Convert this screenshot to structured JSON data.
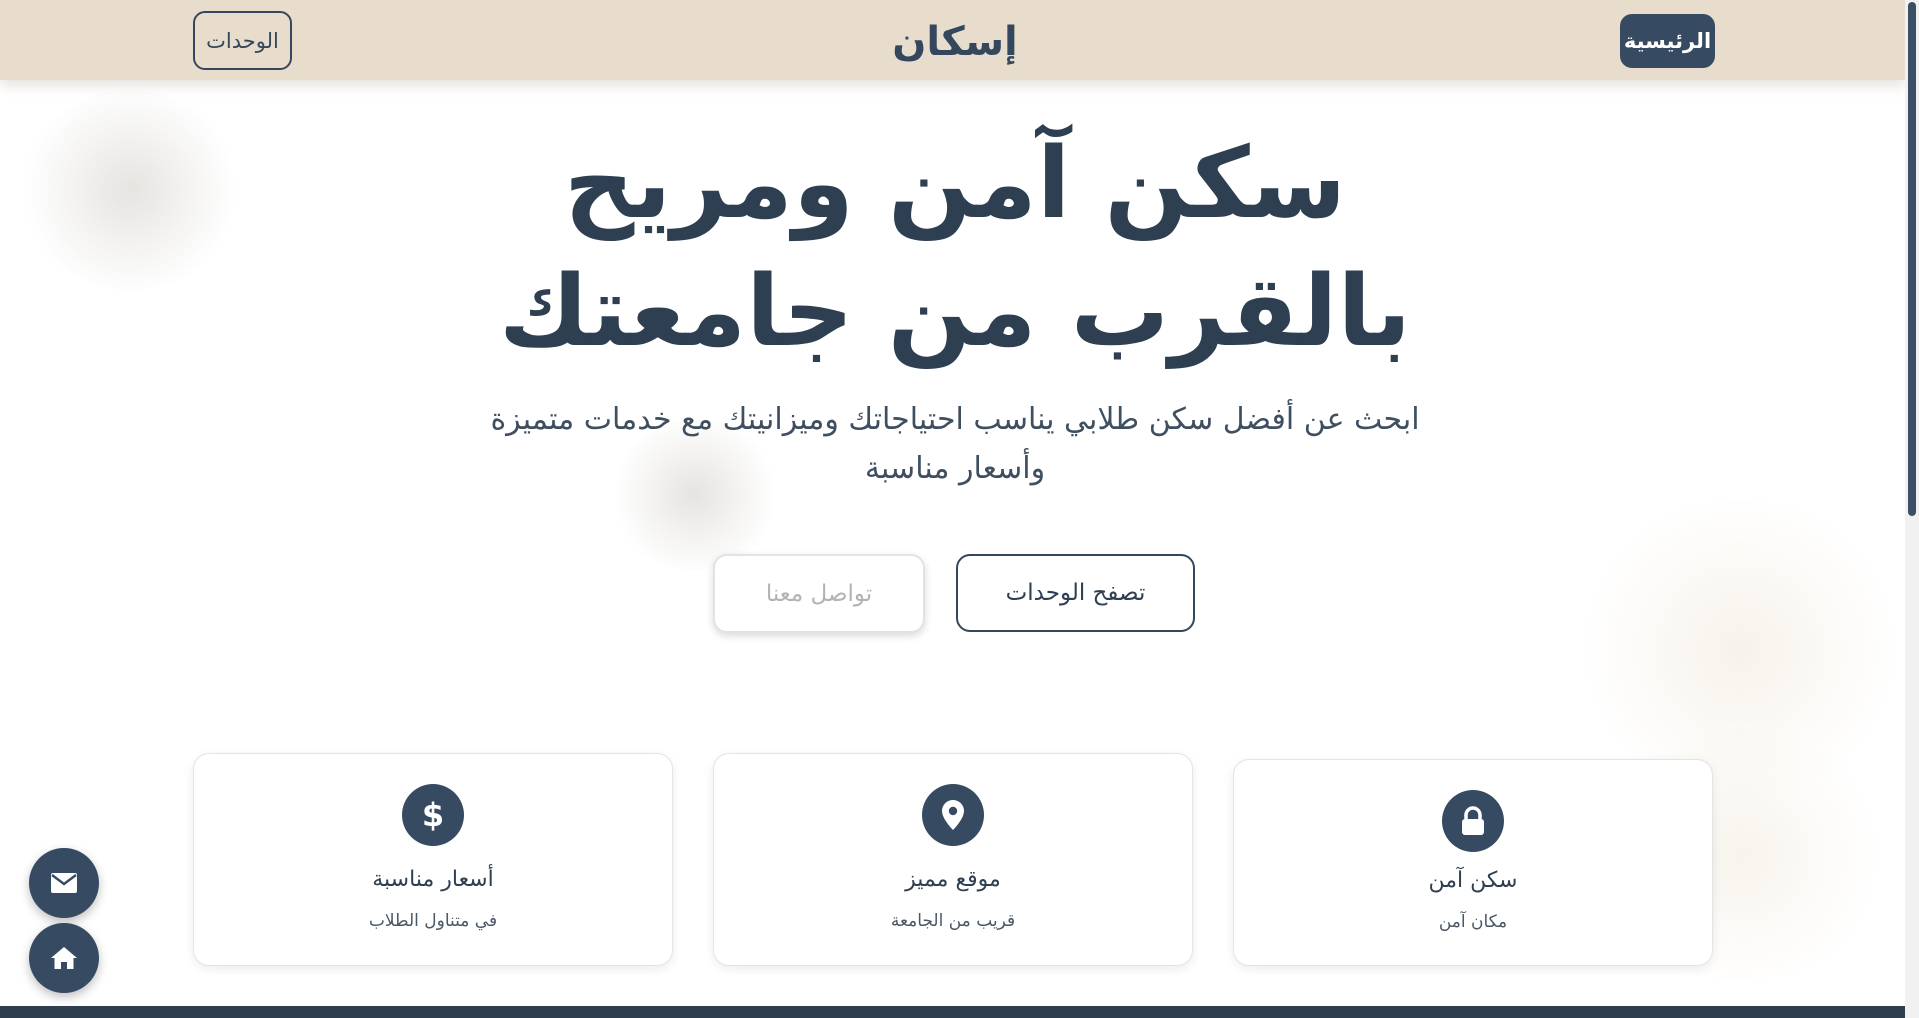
{
  "header": {
    "home_label": "الرئيسية",
    "logo_text": "إسكان",
    "units_label": "الوحدات"
  },
  "hero": {
    "title_line1": "سكن آمن ومريح",
    "title_line2": "بالقرب من جامعتك",
    "subtitle_line1": "ابحث عن أفضل سكن طلابي يناسب احتياجاتك وميزانيتك مع خدمات متميزة",
    "subtitle_line2": "وأسعار مناسبة",
    "browse_button": "تصفح الوحدات",
    "contact_button": "تواصل معنا"
  },
  "features": [
    {
      "icon": "lock-icon",
      "title": "سكن آمن",
      "description": "مكان آمن"
    },
    {
      "icon": "map-marker-icon",
      "title": "موقع مميز",
      "description": "قريب من الجامعة"
    },
    {
      "icon": "dollar-icon",
      "title": "أسعار مناسبة",
      "description": "في متناول الطلاب"
    }
  ],
  "floating_buttons": {
    "mail": "envelope-icon",
    "home": "home-icon"
  },
  "colors": {
    "header_bg": "#e8ddcc",
    "primary": "#364a61",
    "text": "#2e3f52"
  }
}
